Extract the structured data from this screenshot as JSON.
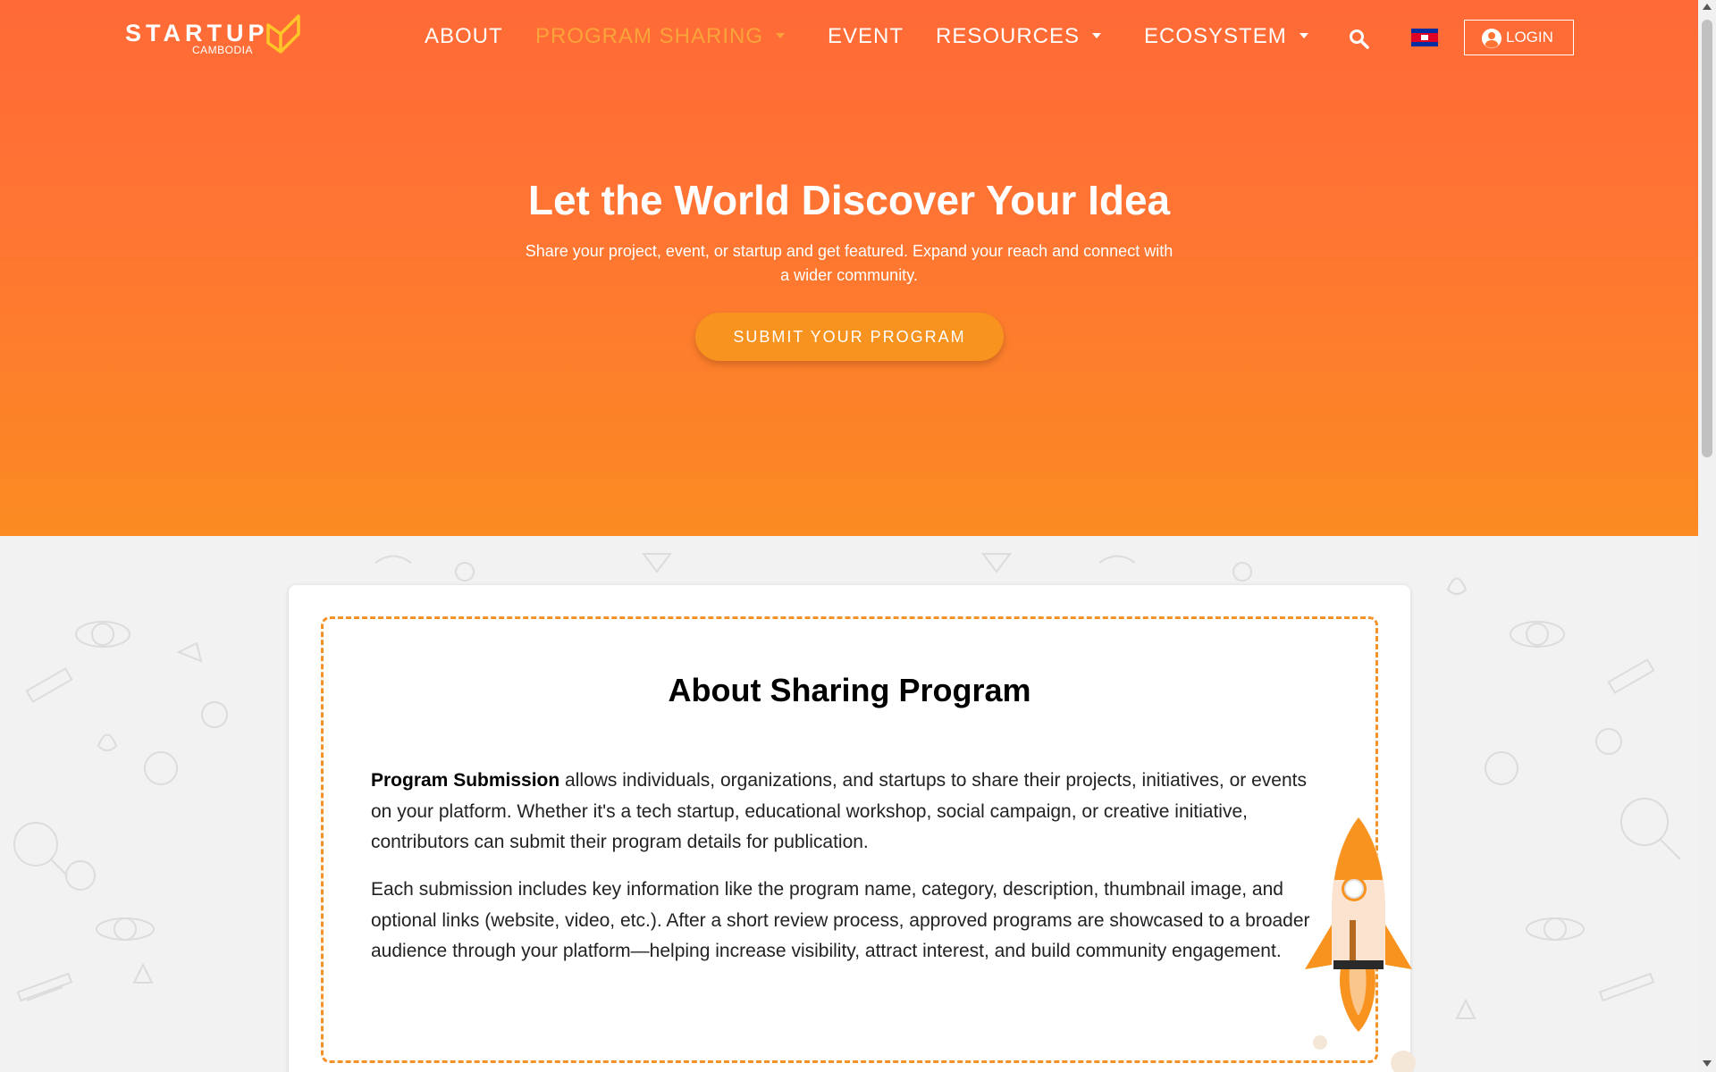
{
  "brand": {
    "logo_text": "STARTUP",
    "logo_sub": "CAMBODIA",
    "logo_color": "#ffc629"
  },
  "nav": {
    "items": [
      {
        "label": "ABOUT",
        "dropdown": false,
        "active": false
      },
      {
        "label": "PROGRAM SHARING",
        "dropdown": true,
        "active": true
      },
      {
        "label": "EVENT",
        "dropdown": false,
        "active": false
      },
      {
        "label": "RESOURCES",
        "dropdown": true,
        "active": false
      },
      {
        "label": "ECOSYSTEM",
        "dropdown": true,
        "active": false
      }
    ],
    "search_icon": "search-icon",
    "language_flag": "cambodia-flag",
    "login_label": "LOGIN",
    "login_icon": "user-circle-icon"
  },
  "hero": {
    "title": "Let the World Discover Your Idea",
    "subtitle_line1": "Share your project, event, or startup and get featured. Expand your reach and connect with",
    "subtitle_line2": "a wider community.",
    "cta_label": "SUBMIT YOUR PROGRAM"
  },
  "about": {
    "title": "About Sharing Program",
    "p1_bold": "Program Submission",
    "p1_rest": " allows individuals, organizations, and startups to share their projects, initiatives, or events on your platform. Whether it's a tech startup, educational workshop, social campaign, or creative initiative, contributors can submit their program details for publication.",
    "p2": "Each submission includes key information like the program name, category, description, thumbnail image, and optional links (website, video, etc.). After a short review process, approved programs are showcased to a broader audience through your platform—helping increase visibility, attract interest, and build community engagement."
  },
  "colors": {
    "hero_top": "#ff6a36",
    "hero_bottom": "#fb8b22",
    "accent": "#f7931e",
    "active_nav": "#f9a43a",
    "dashed_border": "#f4922a"
  }
}
